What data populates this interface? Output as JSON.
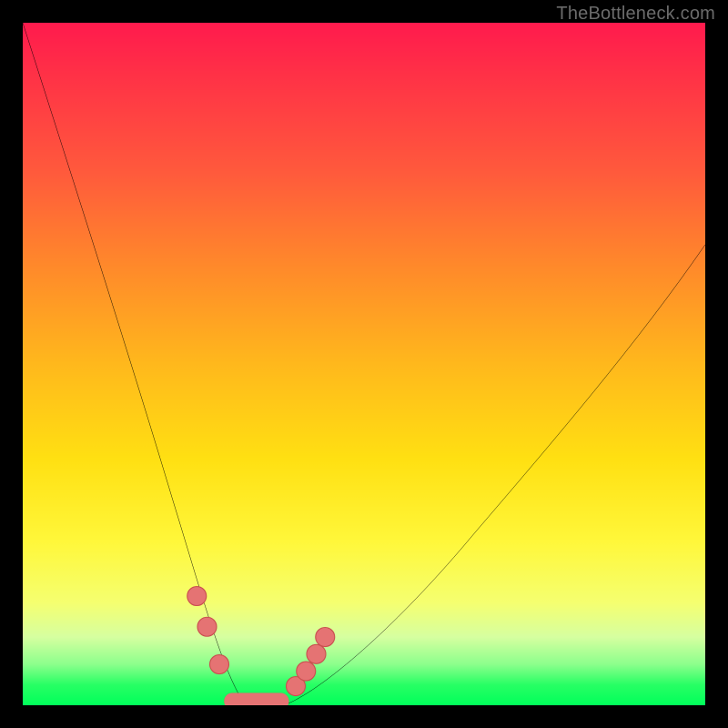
{
  "watermark": "TheBottleneck.com",
  "colors": {
    "frame": "#000000",
    "curve": "#000000",
    "marker_fill": "#e57373",
    "marker_stroke": "#c94f4f",
    "gradient_top": "#ff1a4d",
    "gradient_bottom": "#00ff5a"
  },
  "chart_data": {
    "type": "line",
    "title": "",
    "xlabel": "",
    "ylabel": "",
    "xlim": [
      0,
      100
    ],
    "ylim": [
      0,
      100
    ],
    "x": [
      0,
      3,
      6,
      9,
      12,
      15,
      18,
      21,
      24,
      27,
      29,
      30,
      31,
      32,
      33,
      35,
      36,
      40,
      44,
      48,
      52,
      56,
      60,
      64,
      68,
      72,
      76,
      80,
      84,
      88,
      92,
      96,
      100
    ],
    "values": [
      100,
      90.2,
      80.2,
      70.1,
      60.1,
      50.4,
      41.1,
      32.3,
      24.3,
      16.5,
      9.8,
      6.6,
      3.8,
      1.8,
      0.7,
      0,
      0,
      0.7,
      2.6,
      5.4,
      8.8,
      12.7,
      17.0,
      21.5,
      26.3,
      31.2,
      36.2,
      41.3,
      46.5,
      51.7,
      57.0,
      62.3,
      67.5
    ],
    "annotation": "Curve reaches 0 (green zone) roughly at x 33–38; left branch rises to 100 at x=0; right branch rises to ≈67 at x=100",
    "markers": {
      "note": "pink dots clustered near bottom of valley on both branches plus flat bottom segment",
      "points": [
        {
          "x": 25.5,
          "y": 20
        },
        {
          "x": 27.0,
          "y": 15
        },
        {
          "x": 29.5,
          "y": 7
        },
        {
          "x": 38.5,
          "y": 2
        },
        {
          "x": 40.0,
          "y": 4
        },
        {
          "x": 42.0,
          "y": 7
        },
        {
          "x": 43.5,
          "y": 10
        }
      ],
      "bottom_bar": {
        "x0": 30,
        "x1": 38,
        "y": 0
      }
    }
  }
}
